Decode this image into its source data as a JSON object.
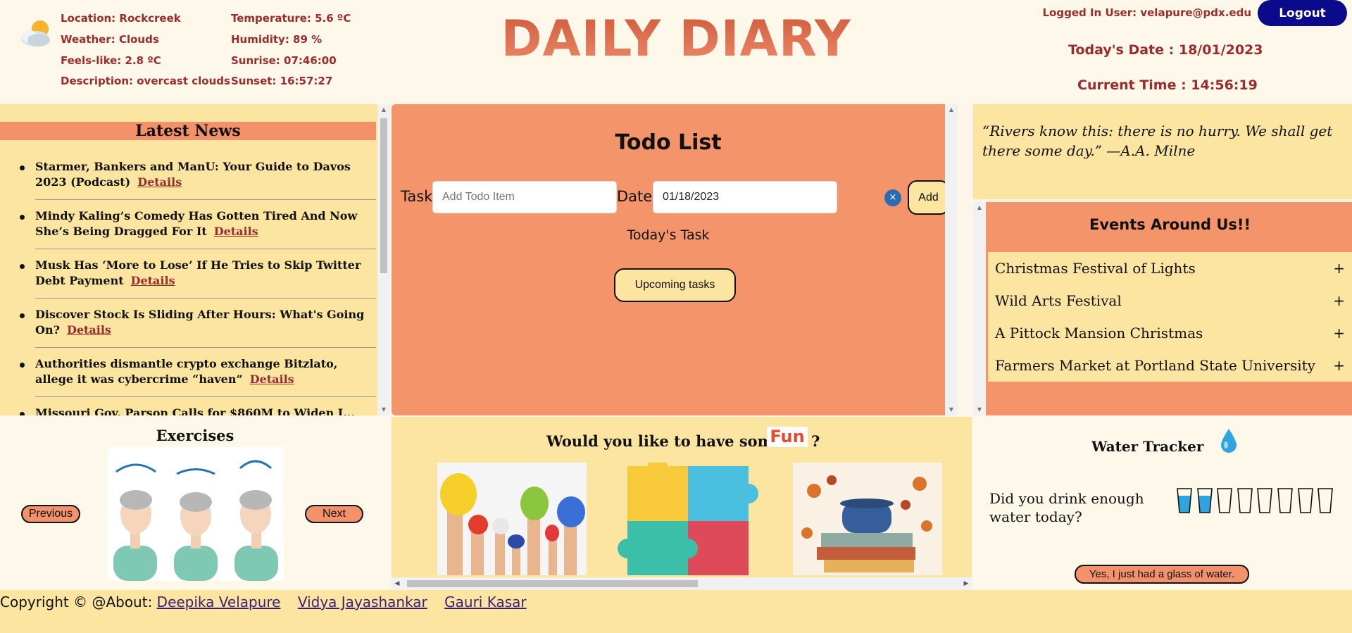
{
  "header": {
    "app_title": "DAILY DIARY",
    "logged_in_label": "Logged In User: velapure@pdx.edu",
    "logout_label": "Logout",
    "todays_date": "Today's Date : 18/01/2023",
    "current_time": "Current Time : 14:56:19",
    "weather_icon": "cloud-sun-icon",
    "weather": {
      "location": "Location: Rockcreek",
      "condition": "Weather: Clouds",
      "feels_like": "Feels-like: 2.8 ºC",
      "description": "Description: overcast clouds",
      "temperature": "Temperature: 5.6 ºC",
      "humidity": "Humidity: 89 %",
      "sunrise": "Sunrise: 07:46:00",
      "sunset": "Sunset: 16:57:27"
    }
  },
  "news": {
    "heading": "Latest News",
    "details_label": "Details",
    "items": [
      {
        "title": "Starmer, Bankers and ManU: Your Guide to Davos 2023 (Podcast)"
      },
      {
        "title": "Mindy Kaling’s Comedy Has Gotten Tired And Now She’s Being Dragged For It"
      },
      {
        "title": "Musk Has ‘More to Lose’ If He Tries to Skip Twitter Debt Payment"
      },
      {
        "title": "Discover Stock Is Sliding After Hours: What's Going On?"
      },
      {
        "title": "Authorities dismantle crypto exchange Bitzlato, allege it was cybercrime “haven”"
      },
      {
        "title": "Missouri Gov. Parson Calls for $860M to Widen I..."
      }
    ]
  },
  "todo": {
    "title": "Todo List",
    "task_label": "Task",
    "task_placeholder": "Add Todo Item",
    "date_label": "Date:",
    "date_value": "01/18/2023",
    "clear_glyph": "×",
    "add_label": "Add",
    "todays_task_label": "Today's Task",
    "upcoming_label": "Upcoming tasks"
  },
  "quote": {
    "text": "“Rivers know this: there is no hurry. We shall get there some day.” —A.A. Milne"
  },
  "events": {
    "title": "Events Around Us!!",
    "expand_glyph": "+",
    "items": [
      {
        "name": "Christmas Festival of Lights"
      },
      {
        "name": "Wild Arts Festival"
      },
      {
        "name": "A Pittock Mansion Christmas"
      },
      {
        "name": "Farmers Market at Portland State University"
      }
    ]
  },
  "exercises": {
    "title": "Exercises",
    "previous_label": "Previous",
    "next_label": "Next",
    "image": "neck-exercise-illustration"
  },
  "fun": {
    "question": "Would you like to have some",
    "badge": "Fun",
    "question_mark": "?",
    "images": [
      "painted-hands-image",
      "puzzle-pieces-image",
      "autumn-books-teacup-image"
    ]
  },
  "water": {
    "title": "Water Tracker",
    "icon": "water-drop-icon",
    "question": "Did you drink enough water today?",
    "glasses_total": 8,
    "glasses_filled": 2,
    "drink_button_label": "Yes, I just had a glass of water.",
    "fill_color": "#2fa5e0"
  },
  "footer": {
    "prefix": "Copyright © @About:",
    "authors": [
      "Deepika Velapure",
      "Vidya Jayashankar",
      "Gauri Kasar"
    ]
  },
  "colors": {
    "primary_panel": "#f4946b",
    "secondary_panel": "#fbe5a1",
    "header_text": "#9b2c2c",
    "logout_button": "#0a0a8a"
  }
}
